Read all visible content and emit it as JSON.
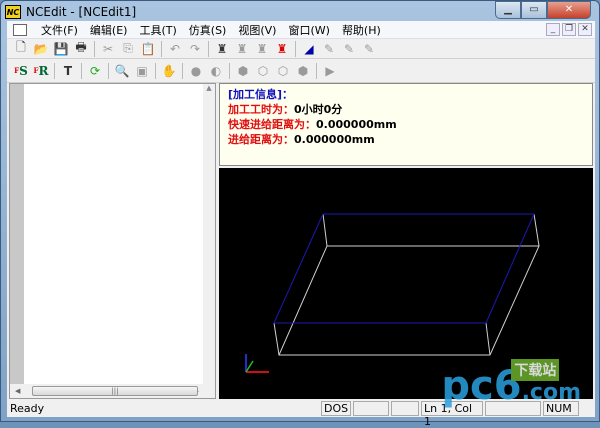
{
  "window": {
    "title": "NCEdit - [NCEdit1]",
    "logo": "NC",
    "controls": [
      "minimize",
      "maximize",
      "close"
    ]
  },
  "menu": [
    "文件(F)",
    "编辑(E)",
    "工具(T)",
    "仿真(S)",
    "视图(V)",
    "窗口(W)",
    "帮助(H)"
  ],
  "toolbar1": [
    "new-icon",
    "open-icon",
    "save-icon",
    "print-icon",
    "cut-icon",
    "copy-icon",
    "paste-icon",
    "undo-icon",
    "redo-icon",
    "find-icon",
    "find-next-icon",
    "replace-icon",
    "find-red-icon",
    "marker-icon",
    "tool-1-icon",
    "tool-2-icon",
    "tool-3-icon"
  ],
  "toolbar2": [
    "fs-icon",
    "fr-icon",
    "tool-t-icon",
    "refresh-icon",
    "zoom-icon",
    "zoom-window-icon",
    "pan-hand-icon",
    "rotate-icon",
    "zoom-out-icon",
    "view-iso-icon",
    "view-front-icon",
    "view-side-icon",
    "view-solid-icon",
    "play-icon"
  ],
  "info": {
    "header": "[加工信息]：",
    "time_label": "加工工时为：",
    "time_value": "0小时0分",
    "rapid_label": "快速进给距离为：",
    "rapid_value": "0.000000mm",
    "feed_label": "进给距离为：",
    "feed_value": "0.000000mm"
  },
  "colors": {
    "box_top": "#1a1ab4",
    "box_lines": "#d0d0d0",
    "view_bg": "#000000",
    "info_header": "#1010c0",
    "info_label": "#e01010"
  },
  "status": {
    "ready": "Ready",
    "encoding": "DOS",
    "position": "Ln 1, Col 1",
    "num": "NUM"
  },
  "watermark": {
    "brand": "pc6",
    "site": ".com",
    "tag": "下载站"
  }
}
